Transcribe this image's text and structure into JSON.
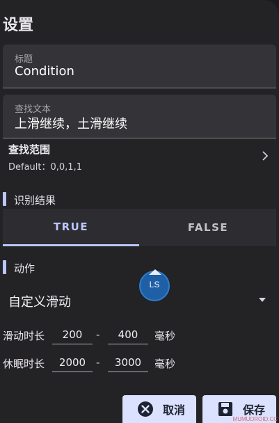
{
  "page": {
    "title": "设置"
  },
  "fields": {
    "title_label": "标题",
    "title_value": "Condition",
    "search_label": "查找文本",
    "search_value": "上滑继续，土滑继续"
  },
  "scope": {
    "title": "查找范围",
    "subtitle": "Default：0,0,1,1"
  },
  "result_section": {
    "label": "识别结果"
  },
  "tabs": [
    {
      "label": "TRUE",
      "selected": true
    },
    {
      "label": "FALSE",
      "selected": false
    }
  ],
  "action_section": {
    "label": "动作"
  },
  "action_select": {
    "value": "自定义滑动"
  },
  "swipe_duration": {
    "label": "滑动时长",
    "min": "200",
    "max": "400",
    "dash": "-",
    "unit": "毫秒"
  },
  "sleep_duration": {
    "label": "休眠时长",
    "min": "2000",
    "max": "3000",
    "dash": "-",
    "unit": "毫秒"
  },
  "buttons": {
    "cancel": "取消",
    "save": "保存"
  },
  "overlay_badge": {
    "text": "LS"
  },
  "watermark": "MUMUDROID.CC",
  "colors": {
    "accent": "#b9c7ff",
    "button_bg": "#dbe2ff",
    "surface": "#232225"
  }
}
